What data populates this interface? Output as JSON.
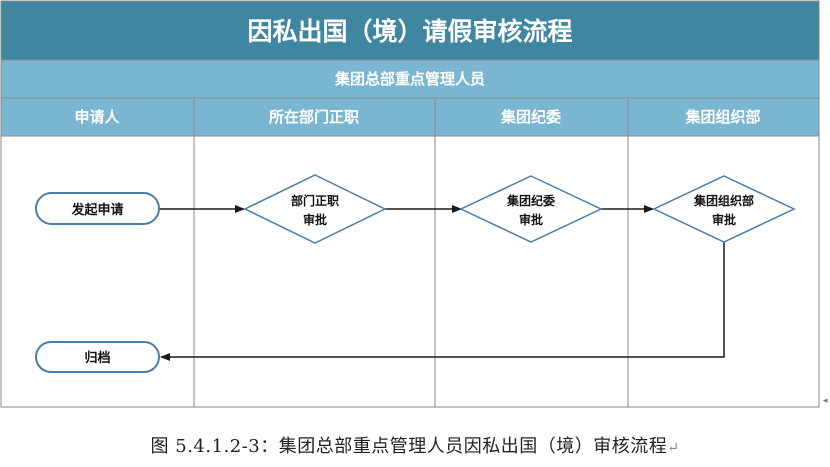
{
  "title": "因私出国（境）请假审核流程",
  "group_label": "集团总部重点管理人员",
  "lanes": [
    "申请人",
    "所在部门正职",
    "集团纪委",
    "集团组织部"
  ],
  "nodes": {
    "apply": "发起申请",
    "dept_line1": "部门正职",
    "dept_line2": "审批",
    "discipline_line1": "集团纪委",
    "discipline_line2": "审批",
    "org_line1": "集团组织部",
    "org_line2": "审批",
    "archive": "归档"
  },
  "caption": "图 5.4.1.2-3：集团总部重点管理人员因私出国（境）审核流程",
  "caption_mark": "↵",
  "edge_mark": "◂",
  "colors": {
    "title_bg": "#3f86a0",
    "title_text": "#ffffff",
    "header_bg": "#7ab6d1",
    "header_text": "#ffffff",
    "node_fill": "#ffffff",
    "node_stroke": "#4a7ea6",
    "border": "#8a8a8a",
    "arrow": "#1a1a1a",
    "node_text": "#111111"
  }
}
